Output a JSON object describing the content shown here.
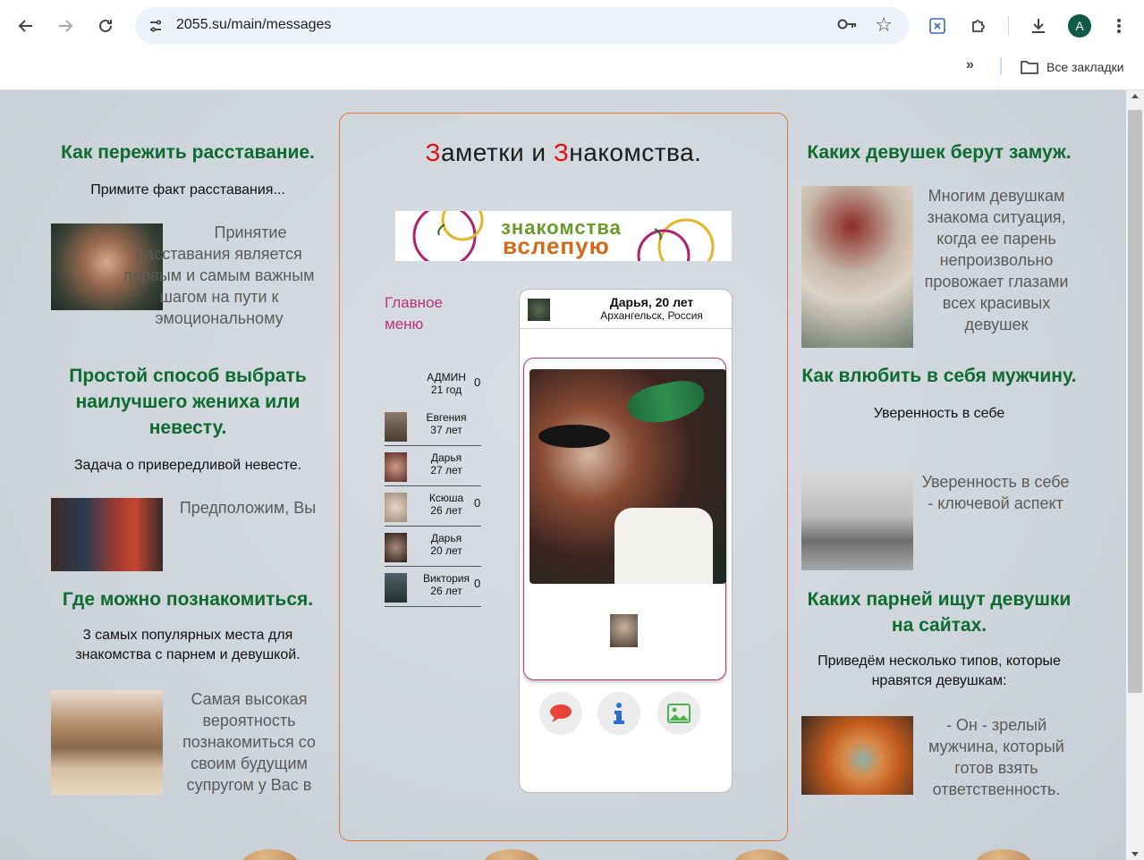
{
  "browser": {
    "url": "2055.su/main/messages",
    "avatar_letter": "A",
    "bookmarks_label": "Все закладки"
  },
  "site": {
    "title_first_letter_1": "З",
    "title_rest_1": "аметки и ",
    "title_first_letter_2": "З",
    "title_rest_2": "накомства.",
    "banner_line1": "знакомства",
    "banner_line2": "вслепую",
    "main_menu": "Главное меню"
  },
  "left_articles": [
    {
      "title": "Как пережить расставание.",
      "lead": "Примите факт расставания...",
      "body": "Принятие расставания является первым и самым важным шагом на пути к эмоциональному"
    },
    {
      "title": "Простой способ выбрать наилучшего жениха или невесту.",
      "lead": "Задача о привередливой невесте.",
      "body": "Предположим, Вы"
    },
    {
      "title": "Где можно познакомиться.",
      "lead": "3 самых популярных места для знакомства с парнем и девушкой.",
      "body": "Самая высокая вероятность познакомиться со своим будущим супругом у Вас в"
    }
  ],
  "right_articles": [
    {
      "title": "Каких девушек берут замуж.",
      "lead": "",
      "body": "Многим девушкам знакома ситуация, когда ее парень непроизвольно провожает глазами всех красивых девушек"
    },
    {
      "title": "Как влюбить в себя мужчину.",
      "lead": "Уверенность в себе",
      "body": "Уверенность в себе - ключевой аспект"
    },
    {
      "title": "Каких парней ищут девушки на сайтах.",
      "lead": "Приведём несколько типов, которые нравятся девушкам:",
      "body": "- Он - зрелый мужчина, который готов взять ответственность."
    }
  ],
  "chats": [
    {
      "name": "АДМИН",
      "age": "21 год",
      "unread": "0"
    },
    {
      "name": "Евгения",
      "age": "37 лет",
      "unread": ""
    },
    {
      "name": "Дарья",
      "age": "27 лет",
      "unread": ""
    },
    {
      "name": "Ксюша",
      "age": "26 лет",
      "unread": "0"
    },
    {
      "name": "Дарья",
      "age": "20 лет",
      "unread": ""
    },
    {
      "name": "Виктория",
      "age": "26 лет",
      "unread": "0"
    }
  ],
  "profile": {
    "name_age": "Дарья, 20 лет",
    "location": "Архангельск, Россия"
  },
  "actions": {
    "chat_icon": "speech-bubble-icon",
    "info_icon": "info-icon",
    "photos_icon": "image-icon",
    "chat_color": "#e8443a",
    "info_color": "#2b6fd6",
    "photos_color": "#4caf50"
  },
  "colors": {
    "heading_green": "#0d6b2f",
    "accent_red": "#e20e0e",
    "panel_border": "#e2763c",
    "menu_pink": "#b7327a"
  }
}
